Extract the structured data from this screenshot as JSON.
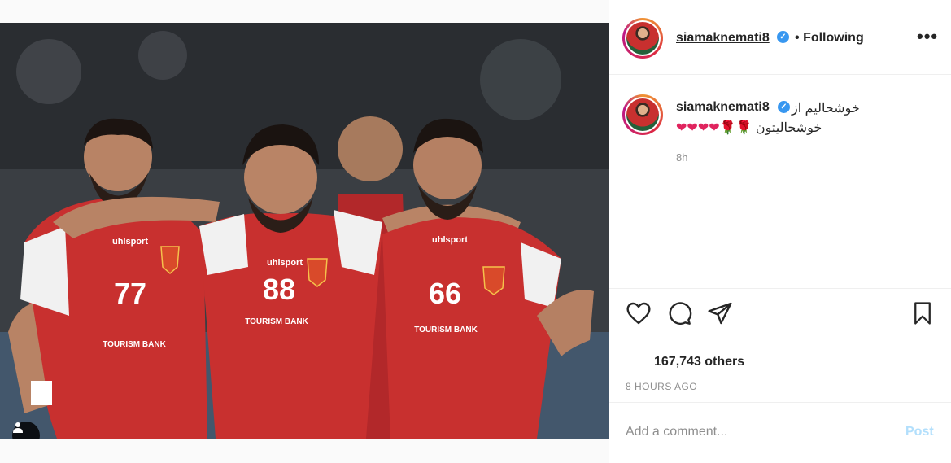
{
  "post": {
    "image_alt": "",
    "jersey_numbers": [
      "77",
      "88",
      "66"
    ],
    "jersey_brand": "uhlsport",
    "jersey_sponsor": "TOURISM BANK"
  },
  "header": {
    "username": "siamaknemati8",
    "separator": "•",
    "follow_status": "Following",
    "more_label": "•••"
  },
  "caption": {
    "username": "siamaknemati8",
    "line1": "خوشحالیم از",
    "line2_text": "خوشحالیتون",
    "emojis": [
      "❤",
      "❤",
      "❤",
      "❤",
      "🌹",
      "🌹"
    ],
    "time": "8h"
  },
  "engagement": {
    "likes_text": "167,743 others",
    "posted_ago": "8 HOURS AGO"
  },
  "comment": {
    "placeholder": "Add a comment...",
    "post_label": "Post"
  },
  "colors": {
    "verified": "#3897f0",
    "post_disabled": "#b2dffc",
    "muted": "#8e8e8e",
    "jersey_red": "#c8302f"
  }
}
